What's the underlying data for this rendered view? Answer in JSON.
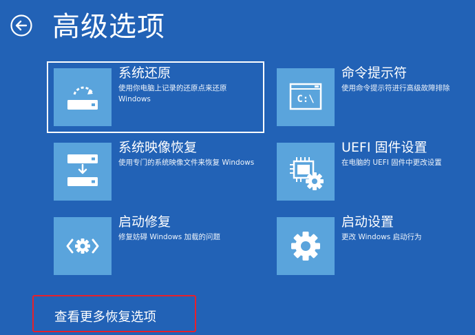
{
  "header": {
    "title": "高级选项"
  },
  "tiles": [
    {
      "title": "系统还原",
      "desc": "使用你电脑上记录的还原点来还原 Windows",
      "icon": "system-restore-icon"
    },
    {
      "title": "命令提示符",
      "desc": "使用命令提示符进行高级故障排除",
      "icon": "command-prompt-icon",
      "icon_text": "C:\\"
    },
    {
      "title": "系统映像恢复",
      "desc": "使用专门的系统映像文件来恢复 Windows",
      "icon": "system-image-icon"
    },
    {
      "title": "UEFI 固件设置",
      "desc": "在电脑的 UEFI 固件中更改设置",
      "icon": "uefi-settings-icon"
    },
    {
      "title": "启动修复",
      "desc": "修复妨碍 Windows 加载的问题",
      "icon": "startup-repair-icon"
    },
    {
      "title": "启动设置",
      "desc": "更改 Windows 启动行为",
      "icon": "startup-settings-icon"
    }
  ],
  "footer": {
    "more_options": "查看更多恢复选项"
  },
  "colors": {
    "background": "#2262b6",
    "icon_tile": "#5aa4dc",
    "highlight_border": "#e8202a"
  }
}
